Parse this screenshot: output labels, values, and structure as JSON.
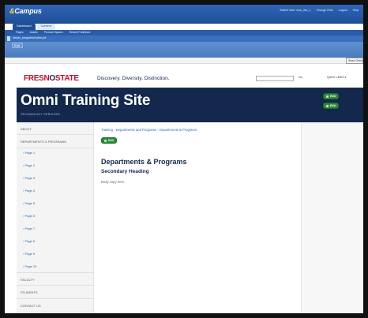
{
  "cms": {
    "logo_main": "Campus",
    "logo_amp": "&",
    "top_links": [
      "Switch User: ews_dev_1",
      "Change Role",
      "Logout",
      "Help"
    ],
    "tabs": [
      "Dashboard",
      "Content"
    ],
    "subnav": [
      "Pages",
      "Assets",
      "Product Spaces",
      "Recent Publishes"
    ],
    "path": "/depts_programs/index.pcf",
    "edit_label": "Edit",
    "more_button": "Word Online"
  },
  "site": {
    "brand_left": "FRESN",
    "brand_o": "O",
    "brand_right": "STATE",
    "tagline": "Discovery. Diversity. Distinction.",
    "search_placeholder": "",
    "go_label": "Go",
    "quick_links": "QUICK LINKS ▾",
    "banner_title": "Omni Training Site",
    "banner_sub": "TECHNOLOGY SERVICES"
  },
  "nav": {
    "about": "ABOUT",
    "depts": "DEPARTMENTS & PROGRAMS",
    "pages": [
      "› Page 1",
      "› Page 2",
      "› Page 3",
      "› Page 4",
      "› Page 5",
      "› Page 6",
      "› Page 7",
      "› Page 8",
      "› Page 9",
      "› Page 10"
    ],
    "faculty": "FACULTY",
    "students": "STUDENTS",
    "contact": "CONTACT US"
  },
  "content": {
    "breadcrumb": "Training › Departments and Programs › Departments & Programs",
    "badge_label": "Edit",
    "heading": "Departments & Programs",
    "subheading": "Secondary Heading",
    "body": "Body copy here."
  },
  "right": {
    "badge1": "Edit",
    "badge2": "Edit"
  },
  "colors": {
    "brand_red": "#c8102e",
    "navy": "#13284c",
    "cms_blue": "#1f4e96",
    "edit_green": "#2f8a3a"
  }
}
